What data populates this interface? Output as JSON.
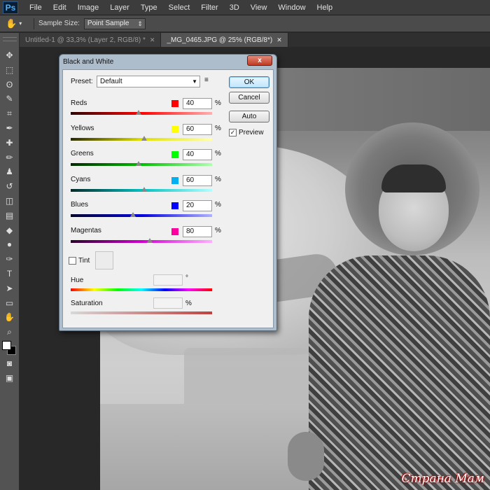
{
  "app": {
    "logo": "Ps"
  },
  "menu": [
    "File",
    "Edit",
    "Image",
    "Layer",
    "Type",
    "Select",
    "Filter",
    "3D",
    "View",
    "Window",
    "Help"
  ],
  "options_bar": {
    "sample_size_label": "Sample Size:",
    "sample_size_value": "Point Sample"
  },
  "tabs": [
    {
      "label": "Untitled-1 @ 33,3% (Layer 2, RGB/8) *",
      "active": false
    },
    {
      "label": "_MG_0465.JPG @ 25% (RGB/8*)",
      "active": true
    }
  ],
  "toolbox": {
    "icons": [
      "move-icon",
      "marquee-icon",
      "lasso-icon",
      "quick-selection-icon",
      "crop-icon",
      "eyedropper-icon",
      "healing-brush-icon",
      "brush-icon",
      "clone-stamp-icon",
      "history-brush-icon",
      "eraser-icon",
      "gradient-icon",
      "blur-icon",
      "dodge-icon",
      "pen-icon",
      "type-icon",
      "path-selection-icon",
      "rectangle-icon",
      "hand-icon",
      "zoom-icon"
    ],
    "glyphs": [
      "✥",
      "⬚",
      "ʘ",
      "✎",
      "⌗",
      "✒",
      "✚",
      "✏",
      "♟",
      "↺",
      "◫",
      "▤",
      "◆",
      "●",
      "✑",
      "T",
      "➤",
      "▭",
      "✋",
      "⌕"
    ]
  },
  "dialog": {
    "title": "Black and White",
    "close_label": "x",
    "preset_label": "Preset:",
    "preset_value": "Default",
    "buttons": {
      "ok": "OK",
      "cancel": "Cancel",
      "auto": "Auto"
    },
    "preview_label": "Preview",
    "preview_checked": true,
    "check_mark": "✓",
    "percent_sign": "%",
    "degree_sign": "°",
    "channels": [
      {
        "label": "Reds",
        "value": "40",
        "color": "#ff0000",
        "gradient": [
          "#2a0000",
          "#ff0000",
          "#ffb0b0"
        ]
      },
      {
        "label": "Yellows",
        "value": "60",
        "color": "#ffff00",
        "gradient": [
          "#2a2a00",
          "#e0e000",
          "#ffffb0"
        ]
      },
      {
        "label": "Greens",
        "value": "40",
        "color": "#00ff00",
        "gradient": [
          "#002a00",
          "#00c000",
          "#b0ffb0"
        ]
      },
      {
        "label": "Cyans",
        "value": "60",
        "color": "#00b0f0",
        "gradient": [
          "#002a2a",
          "#00c0c0",
          "#b0ffff"
        ]
      },
      {
        "label": "Blues",
        "value": "20",
        "color": "#0000ff",
        "gradient": [
          "#00002a",
          "#0000e0",
          "#b0b0ff"
        ]
      },
      {
        "label": "Magentas",
        "value": "80",
        "color": "#ff00a0",
        "gradient": [
          "#2a002a",
          "#d000d0",
          "#ffb0ff"
        ]
      }
    ],
    "tint_label": "Tint",
    "tint_checked": false,
    "hue_label": "Hue",
    "saturation_label": "Saturation"
  },
  "watermark": "Страна Мам"
}
